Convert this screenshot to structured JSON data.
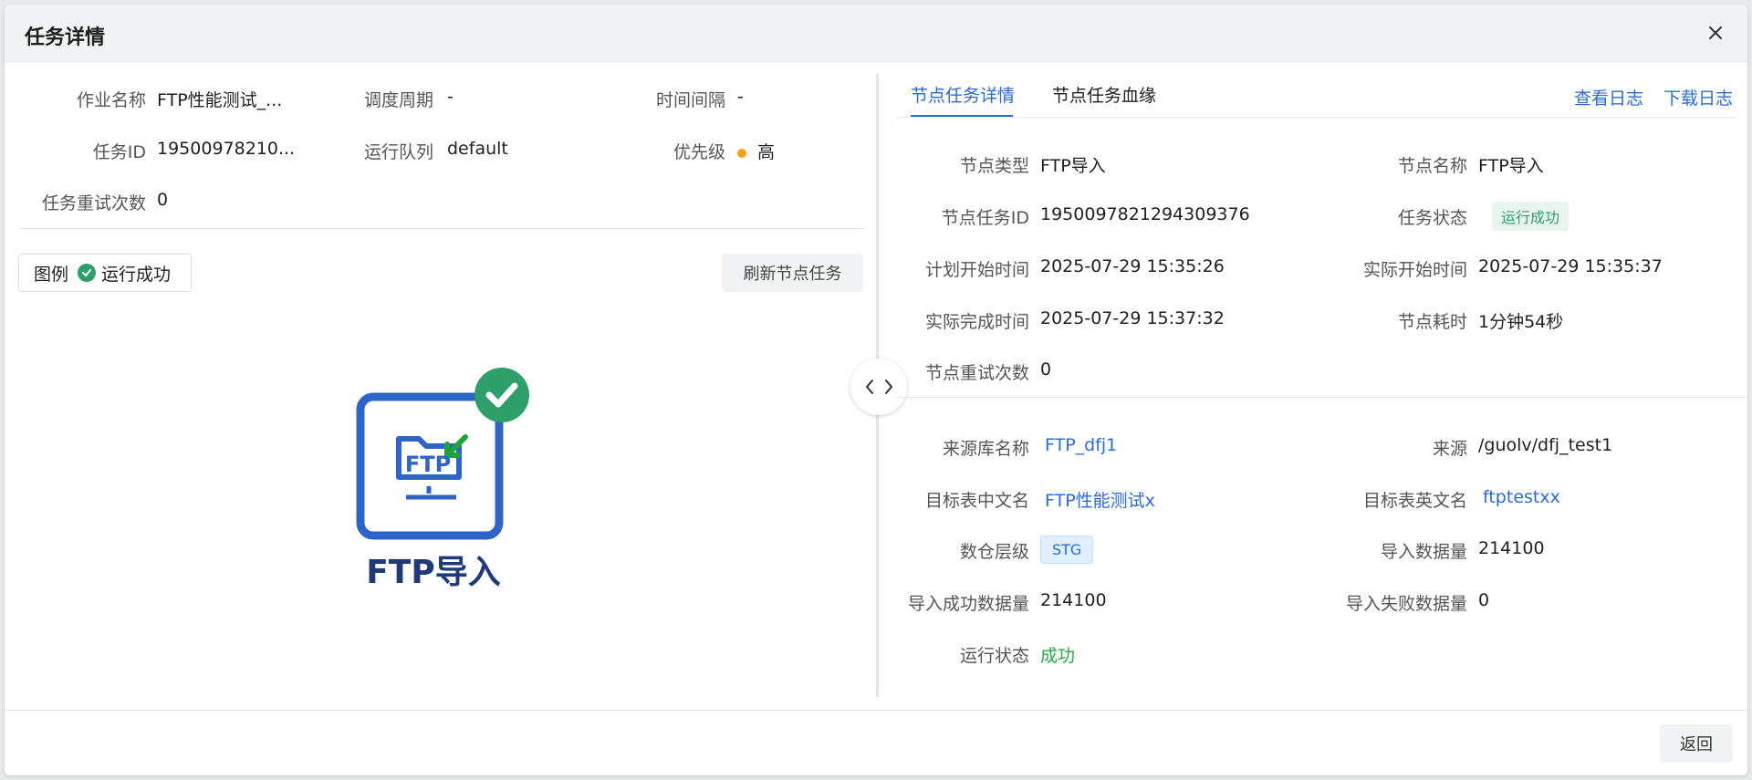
{
  "modal": {
    "title": "任务详情",
    "back_label": "返回"
  },
  "job": {
    "fields": [
      {
        "label": "作业名称",
        "value": "FTP性能测试_..."
      },
      {
        "label": "调度周期",
        "value": "-"
      },
      {
        "label": "时间间隔",
        "value": "-"
      },
      {
        "label": "任务ID",
        "value": "19500978210..."
      },
      {
        "label": "运行队列",
        "value": "default"
      },
      {
        "label": "优先级",
        "value": "高"
      },
      {
        "label": "任务重试次数",
        "value": "0"
      }
    ]
  },
  "legend": {
    "label": "图例",
    "item": "运行成功"
  },
  "refresh_label": "刷新节点任务",
  "node": {
    "icon_text": "FTP",
    "caption": "FTP导入"
  },
  "tabs": [
    {
      "label": "节点任务详情",
      "active": true
    },
    {
      "label": "节点任务血缘",
      "active": false
    }
  ],
  "actions": {
    "view_log": "查看日志",
    "download_log": "下载日志"
  },
  "details": [
    {
      "label": "节点类型",
      "value": "FTP导入"
    },
    {
      "label": "节点名称",
      "value": "FTP导入"
    },
    {
      "label": "节点任务ID",
      "value": "1950097821294309376"
    },
    {
      "label": "任务状态",
      "value": "运行成功"
    },
    {
      "label": "计划开始时间",
      "value": "2025-07-29 15:35:26"
    },
    {
      "label": "实际开始时间",
      "value": "2025-07-29 15:35:37"
    },
    {
      "label": "实际完成时间",
      "value": "2025-07-29 15:37:32"
    },
    {
      "label": "节点耗时",
      "value": "1分钟54秒"
    },
    {
      "label": "节点重试次数",
      "value": "0"
    }
  ],
  "source": [
    {
      "label": "来源库名称",
      "value": "FTP_dfj1"
    },
    {
      "label": "来源",
      "value": "/guolv/dfj_test1"
    },
    {
      "label": "目标表中文名",
      "value": "FTP性能测试x"
    },
    {
      "label": "目标表英文名",
      "value": "ftptestxx"
    },
    {
      "label": "数仓层级",
      "value": "STG"
    },
    {
      "label": "导入数据量",
      "value": "214100"
    },
    {
      "label": "导入成功数据量",
      "value": "214100"
    },
    {
      "label": "导入失败数据量",
      "value": "0"
    },
    {
      "label": "运行状态",
      "value": "成功"
    }
  ],
  "colors": {
    "accent": "#2d6bd1",
    "success": "#2e9e6b",
    "status_ok": "#2aa545",
    "priority_high": "#ff9c1a"
  }
}
